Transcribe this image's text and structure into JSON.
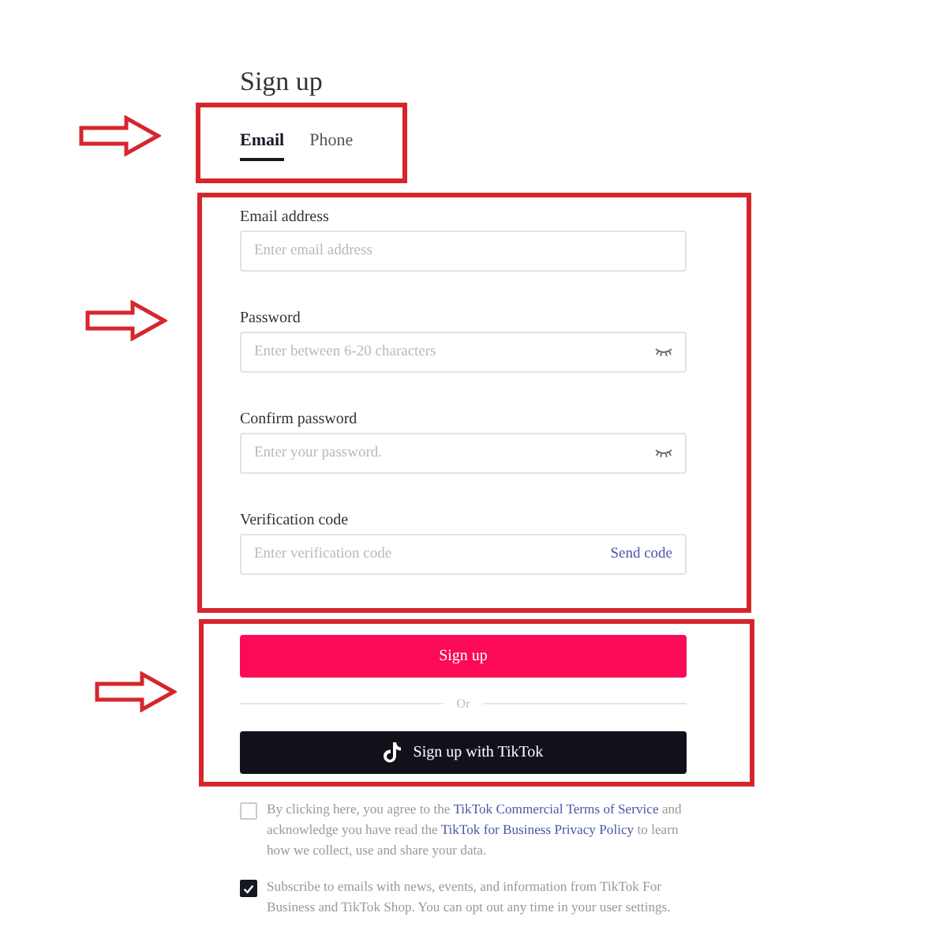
{
  "title": "Sign up",
  "tabs": [
    {
      "label": "Email",
      "selected": true
    },
    {
      "label": "Phone",
      "selected": false
    }
  ],
  "fields": [
    {
      "label": "Email address",
      "placeholder": "Enter email address",
      "kind": "text"
    },
    {
      "label": "Password",
      "placeholder": "Enter between 6-20 characters",
      "kind": "password"
    },
    {
      "label": "Confirm password",
      "placeholder": "Enter your password.",
      "kind": "password"
    },
    {
      "label": "Verification code",
      "placeholder": "Enter verification code",
      "kind": "code",
      "action": "Send code"
    }
  ],
  "primary_button": "Sign up",
  "divider": "Or",
  "tiktok_button": "Sign up with TikTok",
  "consents": [
    {
      "checked": false,
      "parts": [
        {
          "kind": "text",
          "text": "By clicking here, you agree to the "
        },
        {
          "kind": "link",
          "text": "TikTok Commercial Terms of Service"
        },
        {
          "kind": "text",
          "text": " and acknowledge you have read the "
        },
        {
          "kind": "link",
          "text": "TikTok for Business Privacy Policy"
        },
        {
          "kind": "text",
          "text": " to learn how we collect, use and share your data."
        }
      ]
    },
    {
      "checked": true,
      "parts": [
        {
          "kind": "text",
          "text": "Subscribe to emails with news, events, and information from TikTok For Business and TikTok Shop. You can opt out any time in your user settings."
        }
      ]
    }
  ]
}
